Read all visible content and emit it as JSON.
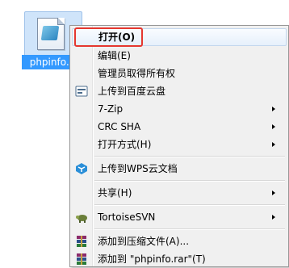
{
  "desktop": {
    "file_name": "phpinfo.p"
  },
  "context_menu": {
    "items": [
      {
        "label": "打开(O)"
      },
      {
        "label": "编辑(E)"
      },
      {
        "label": "管理员取得所有权"
      },
      {
        "label": "上传到百度云盘"
      },
      {
        "label": "7-Zip"
      },
      {
        "label": "CRC SHA"
      },
      {
        "label": "打开方式(H)"
      },
      {
        "label": "上传到WPS云文档"
      },
      {
        "label": "共享(H)"
      },
      {
        "label": "TortoiseSVN"
      },
      {
        "label": "添加到压缩文件(A)..."
      },
      {
        "label": "添加到 \"phpinfo.rar\"(T)"
      }
    ]
  },
  "colors": {
    "selection_blue": "#3399ff",
    "highlight_border": "#e5372f",
    "menu_background": "#f0f0f0"
  }
}
